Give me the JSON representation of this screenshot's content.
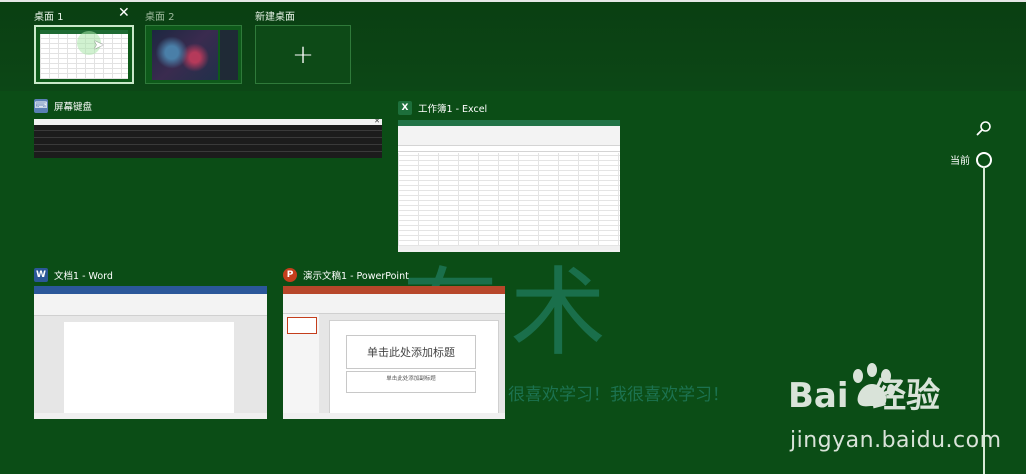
{
  "desktops": [
    {
      "label": "桌面 1",
      "active": true,
      "close": "✕"
    },
    {
      "label": "桌面 2",
      "active": false
    },
    {
      "label": "新建桌面",
      "plus": "+"
    }
  ],
  "windows": [
    {
      "title": "屏幕键盘",
      "icon": "keyboard-icon"
    },
    {
      "title": "工作簿1 - Excel",
      "icon_text": "X",
      "icon": "excel-icon"
    },
    {
      "title": "文档1 - Word",
      "icon_text": "W",
      "icon": "word-icon"
    },
    {
      "title": "演示文稿1 - PowerPoint",
      "icon_text": "P",
      "icon": "powerpoint-icon"
    }
  ],
  "ppt_slide": {
    "title_placeholder": "单击此处添加标题",
    "subtitle_placeholder": "单击此处添加副标题"
  },
  "timeline": {
    "label": "当前"
  },
  "watermark": {
    "big_text": "有术",
    "small_text": "很喜欢学习！我很喜欢学习！",
    "baidu_logo": "Bai  经验",
    "url": "jingyan.baidu.com"
  },
  "colors": {
    "background": "#0b4d16",
    "excel": "#217346",
    "word": "#2b579a",
    "powerpoint": "#b7472a"
  }
}
